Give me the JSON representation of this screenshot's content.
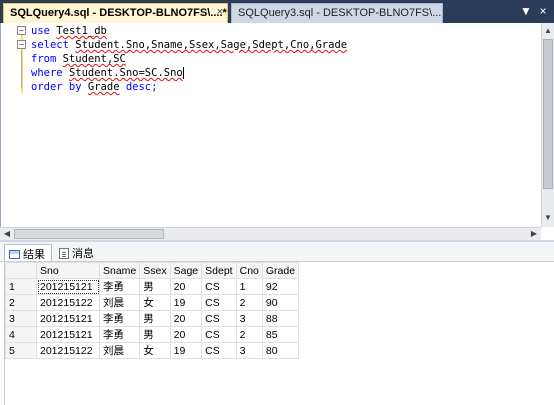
{
  "tabs": [
    {
      "label": "SQLQuery4.sql - DESKTOP-BLNO7FS\\....*",
      "close": "×",
      "active": true
    },
    {
      "label": "SQLQuery3.sql - DESKTOP-BLNO7FS\\....*",
      "active": false
    }
  ],
  "tab_controls": {
    "dropdown": "▼",
    "close": "×"
  },
  "editor": {
    "lines": [
      {
        "kw": "use ",
        "ident": "Test1_db"
      },
      {
        "kw": "select ",
        "ident": "Student.Sno,Sname,Ssex,Sage,Sdept,Cno,Grade"
      },
      {
        "kw": "from ",
        "ident": "Student,SC"
      },
      {
        "kw": "where ",
        "ident": "Student.Sno=SC.Sno"
      },
      {
        "kw": "order by ",
        "ident": "Grade",
        "kw2": " desc;"
      }
    ]
  },
  "result_tabs": [
    {
      "label": "结果",
      "icon": "grid-icon",
      "active": true
    },
    {
      "label": "消息",
      "icon": "messages-icon",
      "active": false
    }
  ],
  "results": {
    "columns": [
      "Sno",
      "Sname",
      "Ssex",
      "Sage",
      "Sdept",
      "Cno",
      "Grade"
    ],
    "rows": [
      [
        "1",
        "201215121",
        "李勇",
        "男",
        "20",
        "CS",
        "1",
        "92"
      ],
      [
        "2",
        "201215122",
        "刘晨",
        "女",
        "19",
        "CS",
        "2",
        "90"
      ],
      [
        "3",
        "201215121",
        "李勇",
        "男",
        "20",
        "CS",
        "3",
        "88"
      ],
      [
        "4",
        "201215121",
        "李勇",
        "男",
        "20",
        "CS",
        "2",
        "85"
      ],
      [
        "5",
        "201215122",
        "刘晨",
        "女",
        "19",
        "CS",
        "3",
        "80"
      ]
    ]
  },
  "colors": {
    "tab_strip": "#2b3c59",
    "keyword": "#0000ff",
    "active_tab": "#fff7d3"
  }
}
